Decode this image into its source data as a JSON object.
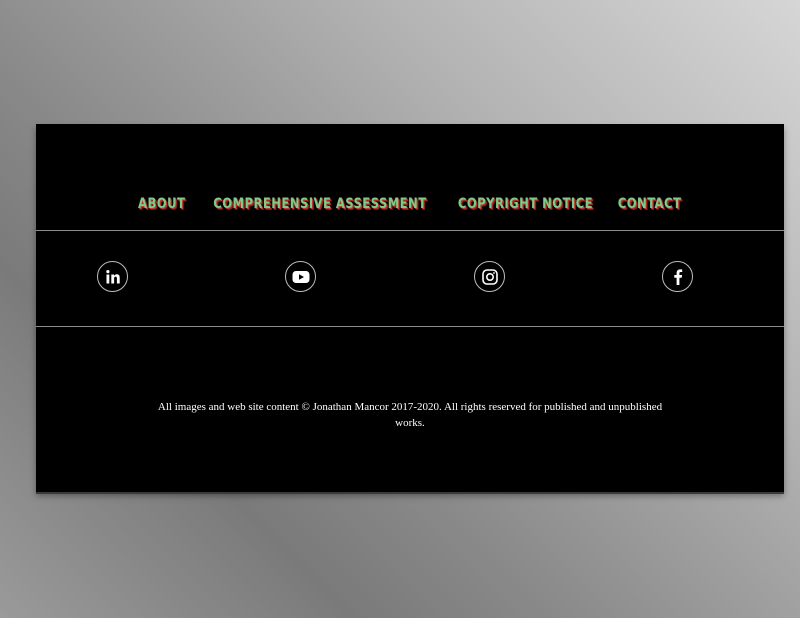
{
  "footer": {
    "nav": {
      "items": [
        {
          "label": "ABOUT"
        },
        {
          "label": "COMPREHENSIVE ASSESSMENT"
        },
        {
          "label": "COPYRIGHT NOTICE"
        },
        {
          "label": "CONTACT"
        }
      ],
      "text_color": "#7fc98a",
      "shadow_color": "#c0392b"
    },
    "social": [
      {
        "name": "linkedin",
        "icon": "linkedin-icon"
      },
      {
        "name": "youtube",
        "icon": "youtube-icon"
      },
      {
        "name": "instagram",
        "icon": "instagram-icon"
      },
      {
        "name": "facebook",
        "icon": "facebook-icon"
      }
    ],
    "copyright": "All images and web site content © Jonathan Mancor 2017-2020. All rights reserved for published and unpublished works.",
    "background_color": "#000000"
  }
}
